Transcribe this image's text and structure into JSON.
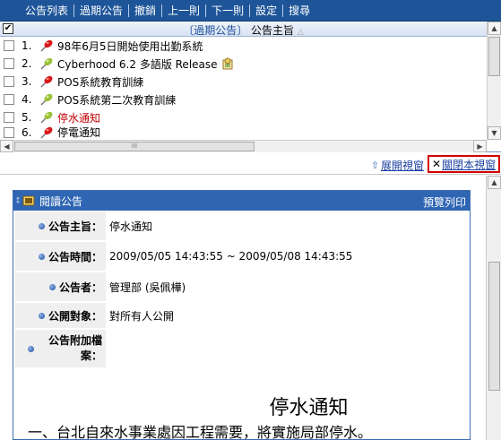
{
  "menu": {
    "items": [
      "公告列表",
      "過期公告",
      "撤銷",
      "上一則",
      "下一則",
      "設定",
      "搜尋"
    ]
  },
  "list": {
    "header_category": "〔過期公告〕",
    "header_column": "公告主旨",
    "header_sort_glyph": "△",
    "rows": [
      {
        "num": "1.",
        "title": "98年6月5日開始使用出勤系統",
        "pin": "red",
        "highlight": false
      },
      {
        "num": "2.",
        "title": "Cyberhood 6.2 多語版 Release",
        "pin": "green",
        "highlight": false,
        "has_badge": true
      },
      {
        "num": "3.",
        "title": "POS系統教育訓練",
        "pin": "red",
        "highlight": false
      },
      {
        "num": "4.",
        "title": "POS系統第二次教育訓練",
        "pin": "green",
        "highlight": false
      },
      {
        "num": "5.",
        "title": "停水通知",
        "pin": "green",
        "highlight": true
      },
      {
        "num": "6.",
        "title": "停電通知",
        "pin": "red",
        "highlight": false
      }
    ],
    "hscroll_grip": "III"
  },
  "midbar": {
    "expand_label": "展開視窗",
    "close_label": "關閉本視窗"
  },
  "detail": {
    "panel_title": "閱讀公告",
    "print_label": "預覽列印",
    "fields": [
      {
        "label": "公告主旨：",
        "value": "停水通知"
      },
      {
        "label": "公告時間：",
        "value": "2009/05/05 14:43:55 ~ 2009/05/08 14:43:55"
      },
      {
        "label": "公告者：",
        "value": "管理部 (吳佩樺)"
      },
      {
        "label": "公開對象：",
        "value": "對所有人公開"
      },
      {
        "label": "公告附加檔案：",
        "value": ""
      }
    ],
    "content_title": "停水通知",
    "content_line1": "一、台北自來水事業處因工程需要，將實施局部停水。"
  },
  "colors": {
    "topbar": "#1e5599",
    "panel_header": "#2f66b3",
    "highlight_text": "#c00000",
    "close_box_border": "#d40000"
  }
}
